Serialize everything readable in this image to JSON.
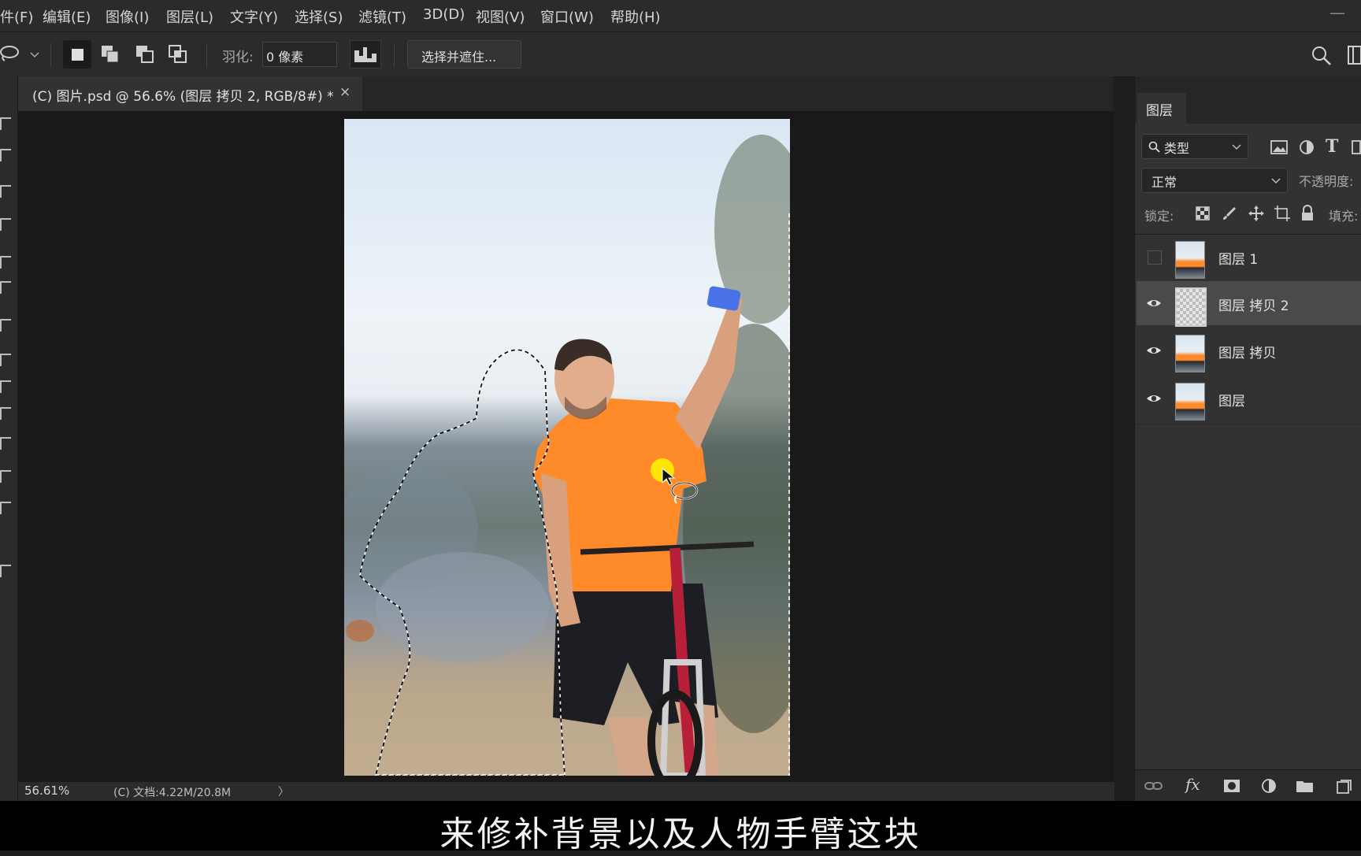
{
  "menubar": {
    "items": [
      "件(F)",
      "编辑(E)",
      "图像(I)",
      "图层(L)",
      "文字(Y)",
      "选择(S)",
      "滤镜(T)",
      "3D(D)",
      "视图(V)",
      "窗口(W)",
      "帮助(H)"
    ]
  },
  "options": {
    "feather_label": "羽化:",
    "feather_value": "0 像素",
    "select_mask_button": "选择并遮住..."
  },
  "document": {
    "tab_title": "(C) 图片.psd @ 56.6% (图层  拷贝 2, RGB/8#) *",
    "close": "×"
  },
  "layers_panel": {
    "tab_label": "图层",
    "filter_label": "类型",
    "blend_mode": "正常",
    "opacity_label": "不透明度:",
    "lock_label": "锁定:",
    "fill_label": "填充:",
    "layers": [
      {
        "name": "图层 1",
        "visible": false,
        "selected": false
      },
      {
        "name": "图层  拷贝 2",
        "visible": true,
        "selected": true
      },
      {
        "name": "图层  拷贝",
        "visible": true,
        "selected": false
      },
      {
        "name": "图层",
        "visible": true,
        "selected": false
      }
    ]
  },
  "status": {
    "zoom": "56.61%",
    "doc_info": "(C) 文档:4.22M/20.8M",
    "arrow": "〉"
  },
  "subtitle": "来修补背景以及人物手臂这块",
  "colors": {
    "shirt": "#ff8a2a",
    "phone": "#4a72e8",
    "cursor_highlight": "#ffee00"
  }
}
